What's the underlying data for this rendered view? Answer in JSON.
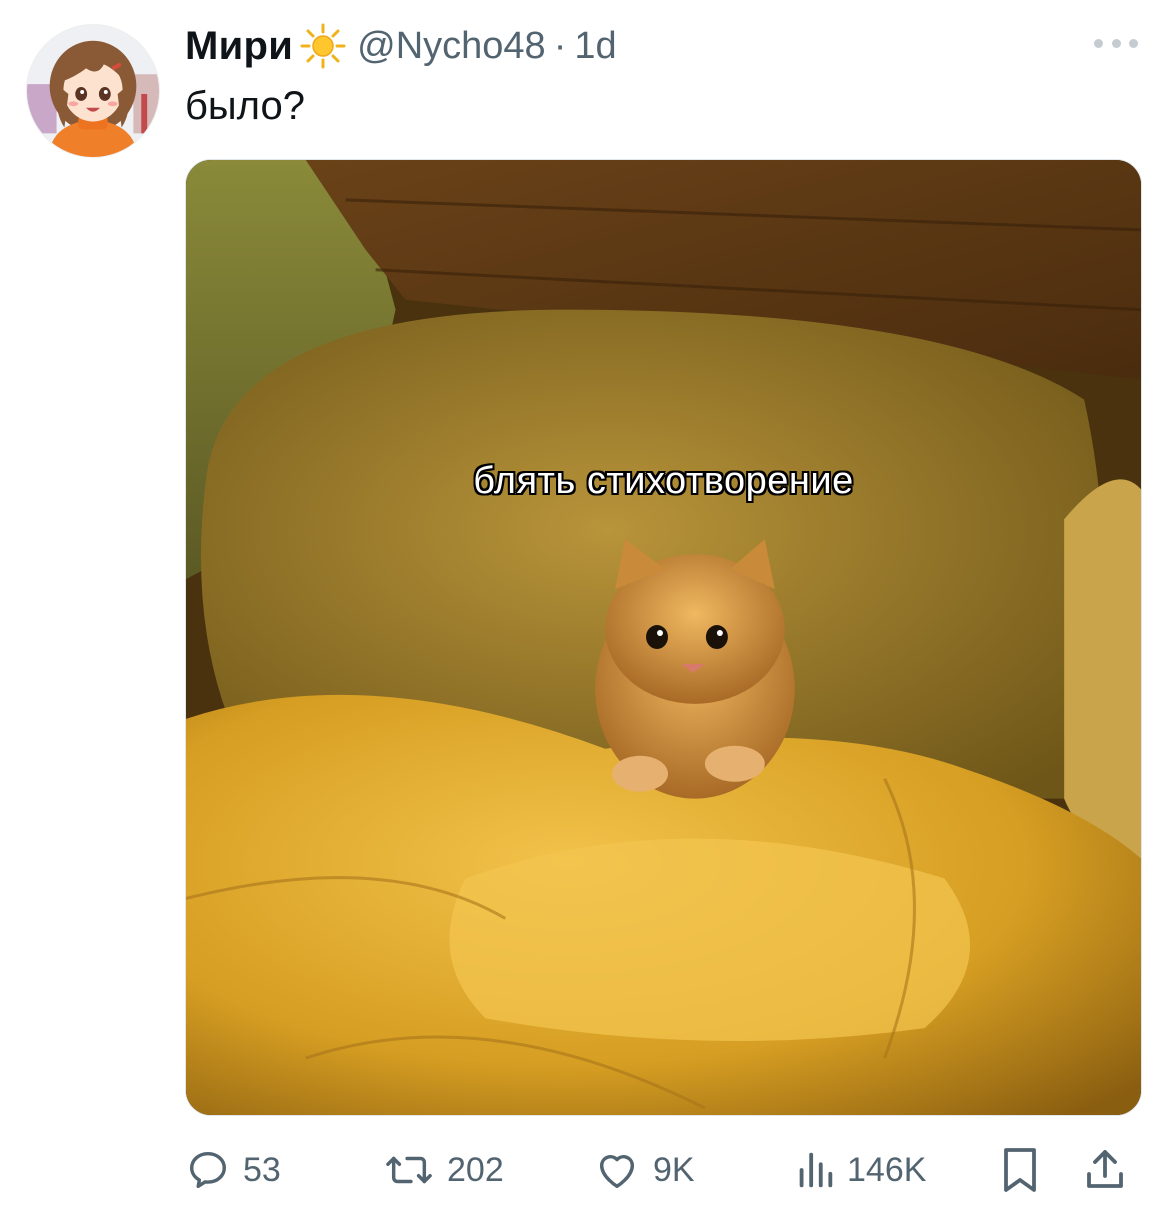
{
  "tweet": {
    "display_name": "Мири",
    "name_emoji_icon": "sun-icon",
    "handle": "@Nycho48",
    "separator": "·",
    "time": "1d",
    "text": "было?",
    "more_icon": "more-horizontal-icon"
  },
  "media": {
    "caption": "блять стихотворение",
    "subject": "kitten-in-bed-photo"
  },
  "actions": {
    "reply_count": "53",
    "retweet_count": "202",
    "like_count": "9K",
    "views_count": "146K"
  },
  "colors": {
    "text_primary": "#0f1419",
    "text_secondary": "#536471"
  }
}
